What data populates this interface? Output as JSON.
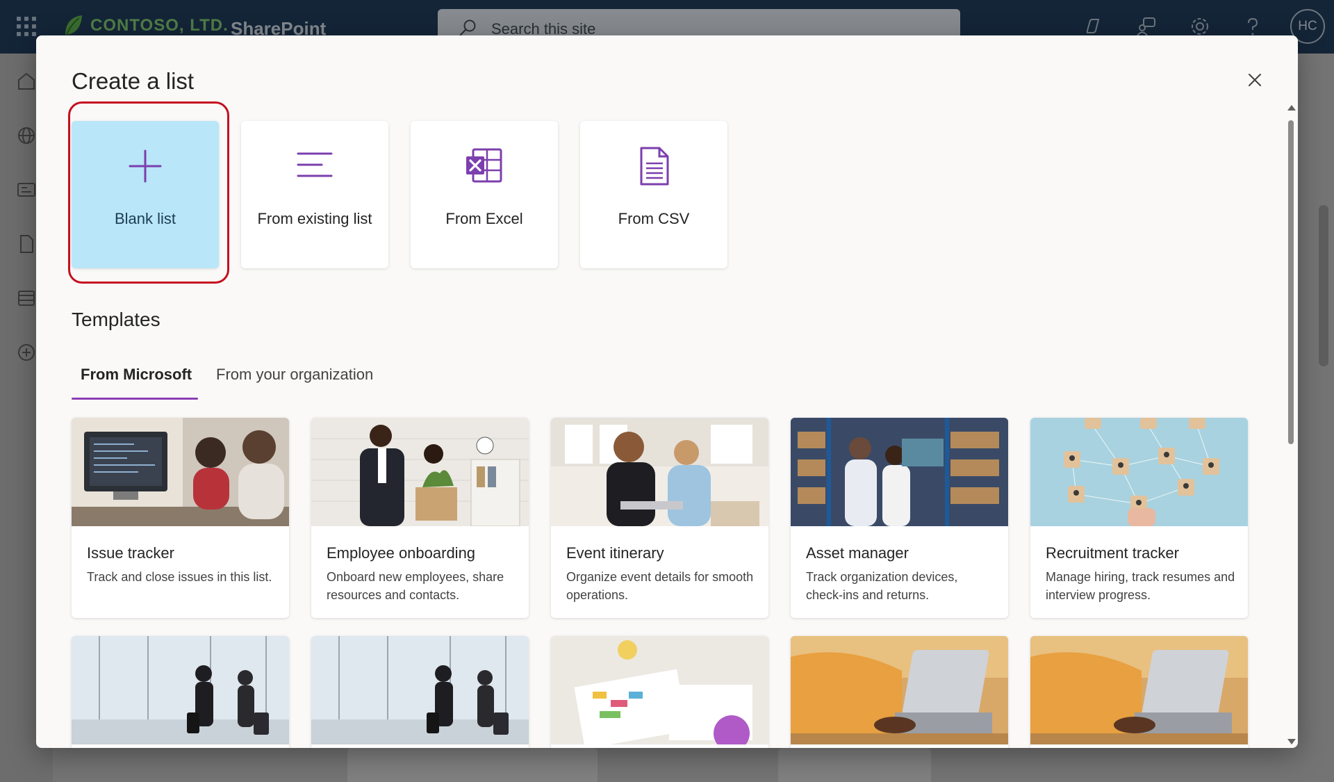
{
  "suite": {
    "brand": "CONTOSO, LTD.",
    "app_name": "SharePoint",
    "search_placeholder": "Search this site",
    "avatar_initials": "HC"
  },
  "modal": {
    "title": "Create a list",
    "create_options": [
      {
        "label": "Blank list",
        "icon": "plus-icon",
        "selected": true
      },
      {
        "label": "From existing list",
        "icon": "list-lines-icon",
        "selected": false
      },
      {
        "label": "From Excel",
        "icon": "excel-icon",
        "selected": false
      },
      {
        "label": "From CSV",
        "icon": "csv-file-icon",
        "selected": false
      }
    ],
    "templates_title": "Templates",
    "tabs": [
      {
        "label": "From Microsoft",
        "active": true
      },
      {
        "label": "From your organization",
        "active": false
      }
    ],
    "templates": [
      {
        "title": "Issue tracker",
        "description": "Track and close issues in this list."
      },
      {
        "title": "Employee onboarding",
        "description": "Onboard new employees, share resources and contacts."
      },
      {
        "title": "Event itinerary",
        "description": "Organize event details for smooth operations."
      },
      {
        "title": "Asset manager",
        "description": "Track organization devices, check-ins and returns."
      },
      {
        "title": "Recruitment tracker",
        "description": "Manage hiring, track resumes and interview progress."
      }
    ]
  },
  "colors": {
    "accent": "#8c3db3",
    "selected_card": "#b9e6f8",
    "highlight_ring": "#c50f1f",
    "suite_bar": "#1f3a57"
  }
}
